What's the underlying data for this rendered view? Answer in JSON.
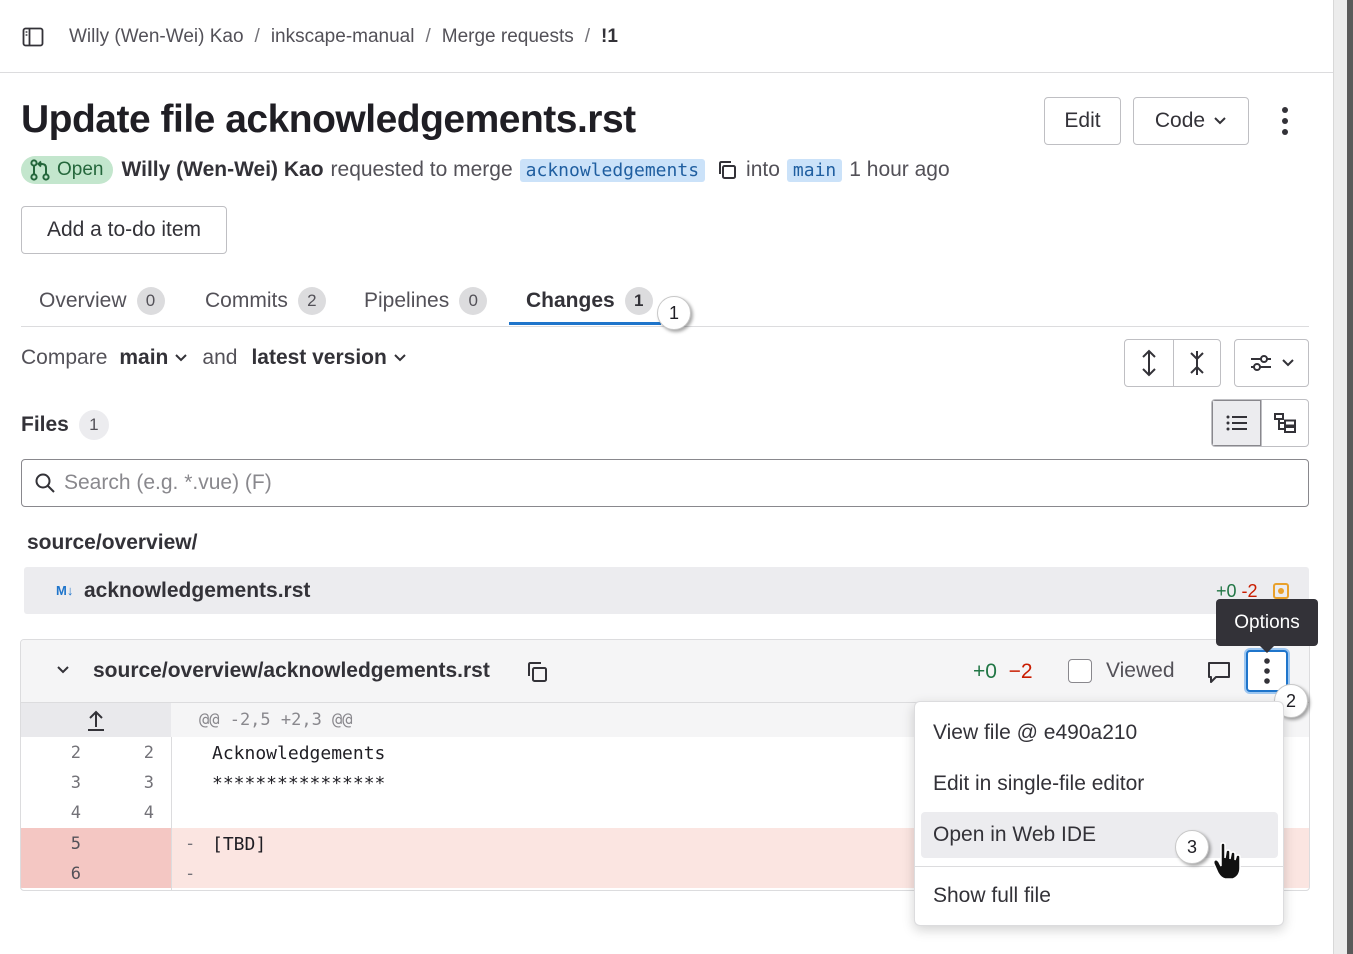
{
  "breadcrumb": {
    "items": [
      "Willy (Wen-Wei) Kao",
      "inkscape-manual",
      "Merge requests",
      "!1"
    ],
    "separator": "/"
  },
  "header": {
    "title": "Update file acknowledgements.rst",
    "edit_label": "Edit",
    "code_label": "Code"
  },
  "meta": {
    "status": "Open",
    "author": "Willy (Wen-Wei) Kao",
    "action_text": "requested to merge",
    "source_branch": "acknowledgements",
    "into_text": "into",
    "target_branch": "main",
    "time": "1 hour ago"
  },
  "todo_label": "Add a to-do item",
  "tabs": [
    {
      "label": "Overview",
      "count": "0"
    },
    {
      "label": "Commits",
      "count": "2"
    },
    {
      "label": "Pipelines",
      "count": "0"
    },
    {
      "label": "Changes",
      "count": "1",
      "active": true
    }
  ],
  "compare": {
    "prefix": "Compare",
    "base": "main",
    "and_text": "and",
    "version": "latest version"
  },
  "files": {
    "label": "Files",
    "count": "1",
    "search_placeholder": "Search (e.g. *.vue) (F)",
    "directory": "source/overview/",
    "tree": [
      {
        "name": "acknowledgements.rst",
        "added": "+0",
        "removed": "-2"
      }
    ]
  },
  "diff": {
    "path": "source/overview/acknowledgements.rst",
    "added": "+0",
    "removed": "−2",
    "viewed_label": "Viewed",
    "hunk_header": "@@ -2,5 +2,3 @@",
    "lines": [
      {
        "old": "2",
        "new": "2",
        "sign": "",
        "code": "Acknowledgements",
        "type": "context"
      },
      {
        "old": "3",
        "new": "3",
        "sign": "",
        "code": "****************",
        "type": "context"
      },
      {
        "old": "4",
        "new": "4",
        "sign": "",
        "code": "",
        "type": "context"
      },
      {
        "old": "5",
        "new": "",
        "sign": "-",
        "code": "[TBD]",
        "type": "removed"
      },
      {
        "old": "6",
        "new": "",
        "sign": "-",
        "code": "",
        "type": "removed"
      }
    ]
  },
  "tooltip": "Options",
  "options_menu": {
    "items": [
      "View file @ e490a210",
      "Edit in single-file editor",
      "Open in Web IDE",
      "Show full file"
    ],
    "highlighted": "Open in Web IDE"
  },
  "markers": [
    "1",
    "2",
    "3"
  ],
  "colors": {
    "accent": "#1f75cb",
    "open_badge_bg": "#c3e6cd",
    "open_badge_fg": "#24663b",
    "added": "#217645",
    "removed": "#c91c00",
    "removed_line_bg": "#fbe5e1",
    "modified_icon": "#e9a12b"
  },
  "icons": [
    "sidebar-toggle-icon",
    "chevron-down-icon",
    "kebab-icon",
    "merge-request-icon",
    "copy-icon",
    "expand-all-icon",
    "collapse-all-icon",
    "settings-icon",
    "list-view-icon",
    "tree-view-icon",
    "search-icon",
    "markdown-icon",
    "file-modified-icon",
    "comment-icon",
    "expand-up-icon",
    "hand-cursor-icon"
  ]
}
